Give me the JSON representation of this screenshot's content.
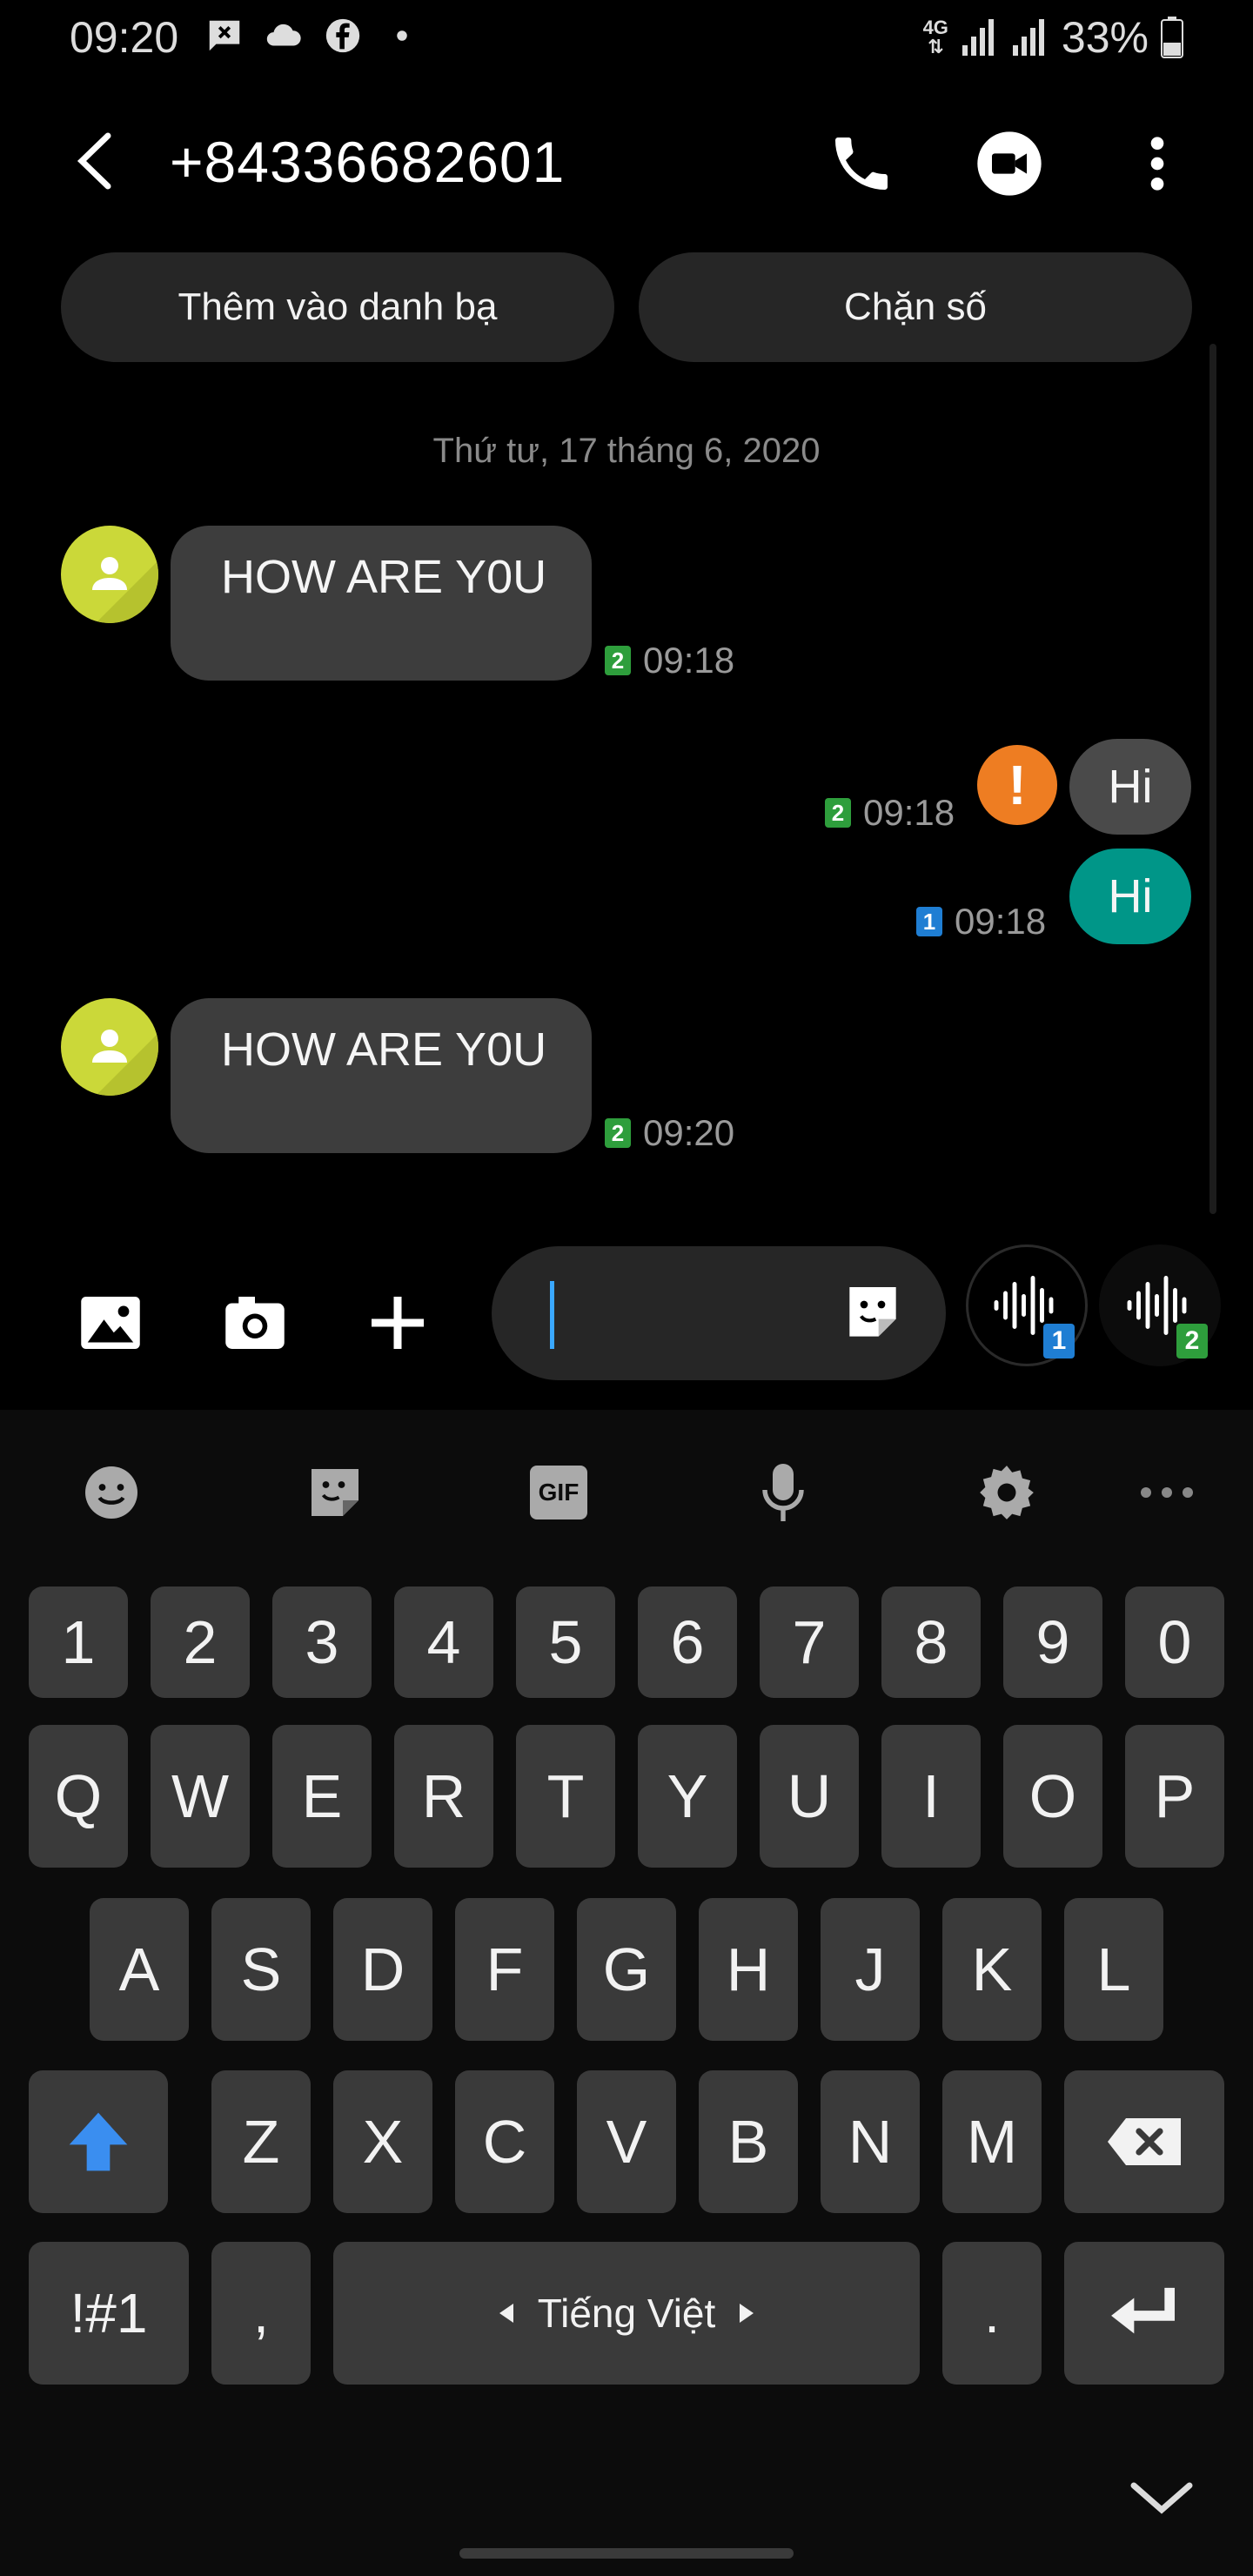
{
  "status_bar": {
    "time": "09:20",
    "network": "4G",
    "battery": "33%"
  },
  "header": {
    "title": "+84336682601"
  },
  "actions": {
    "add_contact": "Thêm vào danh bạ",
    "block": "Chặn số"
  },
  "conversation": {
    "date": "Thứ tư, 17 tháng 6, 2020",
    "messages": [
      {
        "direction": "in",
        "text": "HOW ARE Y0U",
        "sim": "2",
        "time": "09:18"
      },
      {
        "direction": "out",
        "text": "Hi",
        "sim": "2",
        "time": "09:18",
        "status": "failed",
        "error_mark": "!"
      },
      {
        "direction": "out",
        "text": "Hi",
        "sim": "1",
        "time": "09:18"
      },
      {
        "direction": "in",
        "text": "HOW ARE Y0U",
        "sim": "2",
        "time": "09:20"
      }
    ]
  },
  "composer": {
    "input_value": "",
    "voice_sim1": "1",
    "voice_sim2": "2"
  },
  "keyboard": {
    "toolbar": {
      "gif": "GIF"
    },
    "row_numbers": [
      "1",
      "2",
      "3",
      "4",
      "5",
      "6",
      "7",
      "8",
      "9",
      "0"
    ],
    "row1": [
      "Q",
      "W",
      "E",
      "R",
      "T",
      "Y",
      "U",
      "I",
      "O",
      "P"
    ],
    "row2": [
      "A",
      "S",
      "D",
      "F",
      "G",
      "H",
      "J",
      "K",
      "L"
    ],
    "row3": [
      "Z",
      "X",
      "C",
      "V",
      "B",
      "N",
      "M"
    ],
    "symbols_key": "!#1",
    "comma_key": ",",
    "space_label": "Tiếng Việt",
    "period_key": "."
  },
  "colors": {
    "incoming_bubble": "#3d3d3d",
    "outgoing_failed_bubble": "#4a4a4a",
    "outgoing_bubble": "#009688",
    "error": "#ee7d22",
    "avatar": "#cbd839",
    "sim1": "#1f7ed3",
    "sim2": "#2e9e3c",
    "shift": "#3a8ef0"
  }
}
